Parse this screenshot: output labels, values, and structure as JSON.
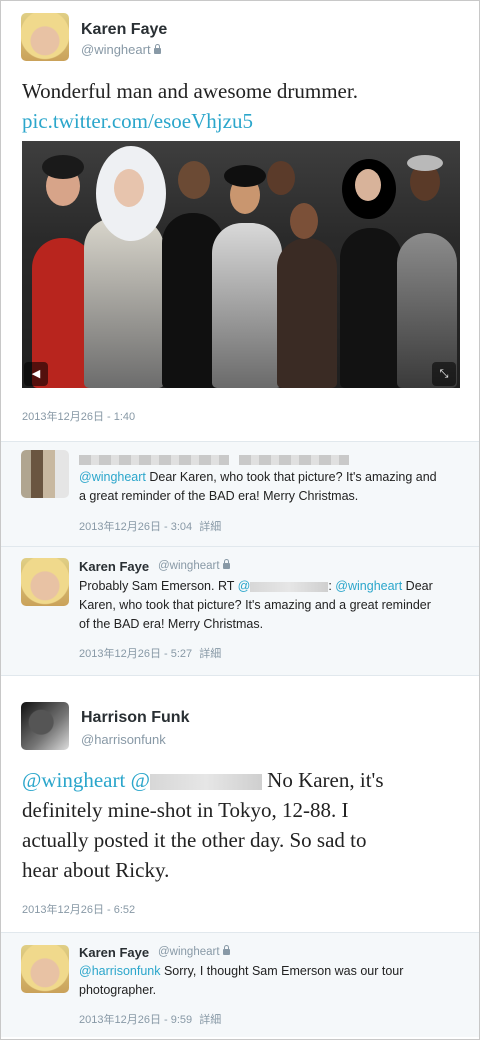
{
  "tweet1": {
    "name": "Karen Faye",
    "handle": "@wingheart",
    "text": "Wonderful man and awesome drummer.",
    "link": "pic.twitter.com/esoeVhjzu5",
    "timestamp": "2013年12月26日 - 1:40"
  },
  "reply1": {
    "mention": "@wingheart",
    "text_line1": " Dear Karen, who took that picture? It's amazing and",
    "text_line2": "a great reminder of the BAD era! Merry Christmas.",
    "timestamp": "2013年12月26日 - 3:04",
    "detail": "詳細"
  },
  "reply2": {
    "name": "Karen Faye",
    "handle": "@wingheart",
    "text_a": "Probably Sam Emerson.  RT ",
    "rt_at": "@",
    "colon": ": ",
    "mention": "@wingheart",
    "text_b": " Dear",
    "text_line2": "Karen, who took that picture? It's amazing and a great reminder",
    "text_line3": "of the BAD era! Merry Christmas.",
    "timestamp": "2013年12月26日 - 5:27",
    "detail": "詳細"
  },
  "tweet2": {
    "name": "Harrison Funk",
    "handle": "@harrisonfunk",
    "mention1": "@wingheart",
    "mention2": "@",
    "text_line1": " No Karen, it's",
    "text_line2": "definitely mine-shot in Tokyo, 12-88. I",
    "text_line3": "actually posted it the other day. So sad to",
    "text_line4": "hear about Ricky.",
    "timestamp": "2013年12月26日 - 6:52"
  },
  "reply3": {
    "name": "Karen Faye",
    "handle": "@wingheart",
    "mention": "@harrisonfunk",
    "text_line1": " Sorry, I thought Sam Emerson was our tour",
    "text_line2": "photographer.",
    "timestamp": "2013年12月26日 - 9:59",
    "detail": "詳細"
  },
  "icons": {
    "prev": "◀",
    "expand": "⤡"
  }
}
